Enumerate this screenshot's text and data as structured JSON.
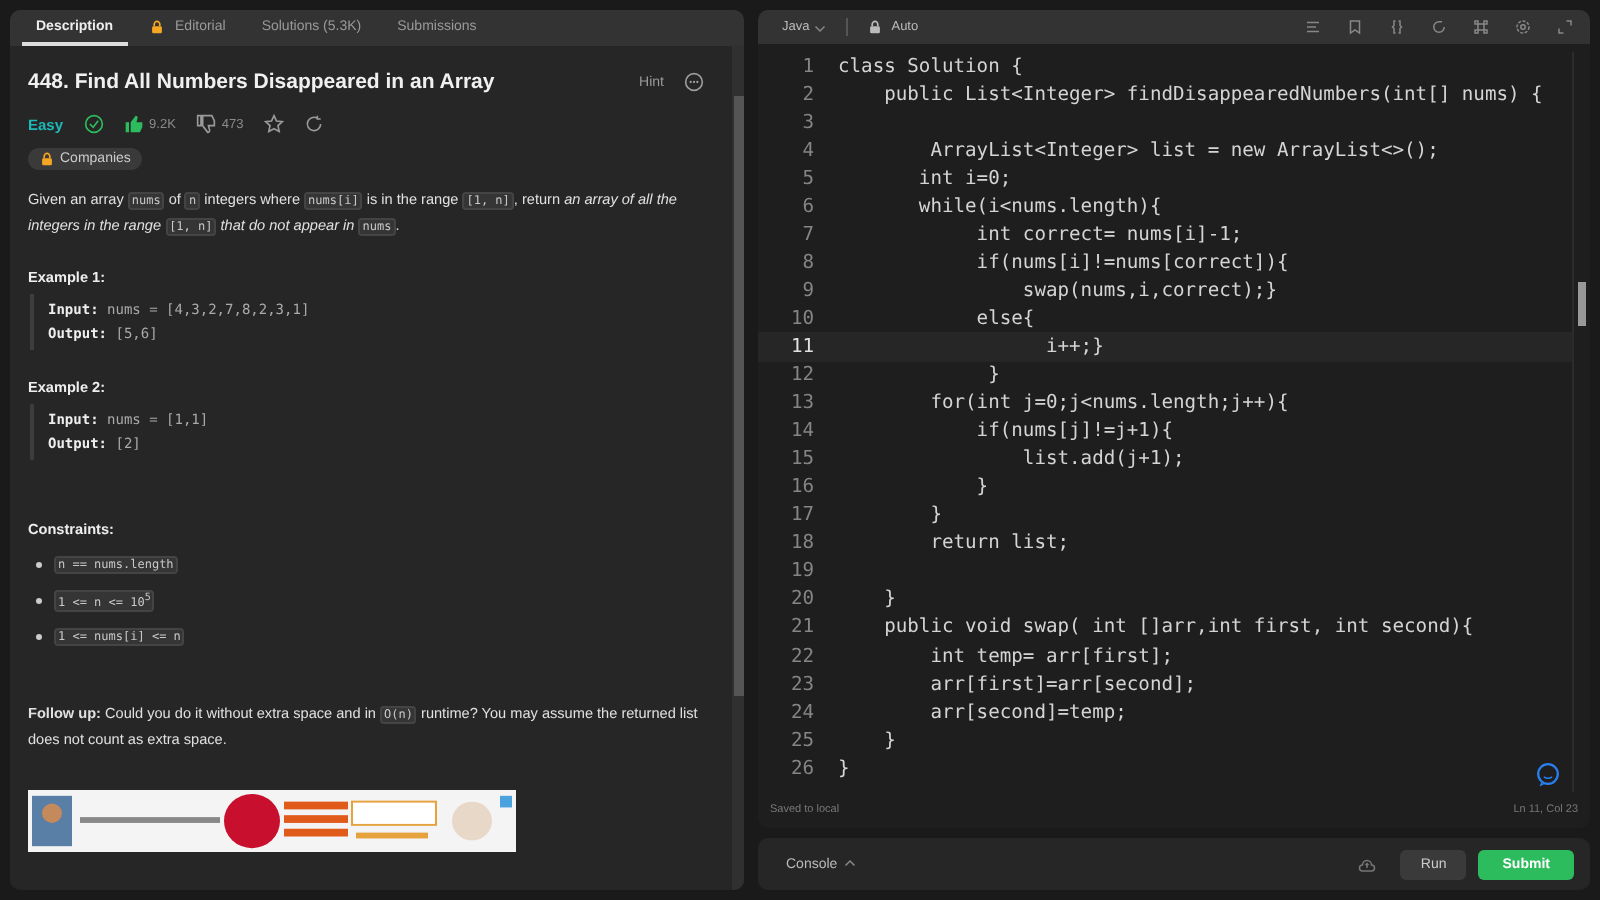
{
  "left_tabs": [
    {
      "label": "Description",
      "selected": true,
      "locked": false
    },
    {
      "label": "Editorial",
      "selected": false,
      "locked": true
    },
    {
      "label": "Solutions (5.3K)",
      "selected": false,
      "locked": false
    },
    {
      "label": "Submissions",
      "selected": false,
      "locked": false
    }
  ],
  "problem": {
    "title": "448. Find All Numbers Disappeared in an Array",
    "hint": "Hint",
    "difficulty": "Easy",
    "solved": true,
    "likes": "9.2K",
    "dislikes": "473",
    "companies": "Companies",
    "statement": [
      {
        "kind": "text",
        "text": "Given an array "
      },
      {
        "kind": "code",
        "text": "nums"
      },
      {
        "kind": "text",
        "text": " of "
      },
      {
        "kind": "code",
        "text": "n"
      },
      {
        "kind": "text",
        "text": " integers where "
      },
      {
        "kind": "code",
        "text": "nums[i]"
      },
      {
        "kind": "text",
        "text": " is in the range "
      },
      {
        "kind": "code",
        "text": "[1, n]"
      },
      {
        "kind": "text",
        "text": ", return "
      },
      {
        "kind": "italic",
        "text": "an array of all the integers in the range "
      },
      {
        "kind": "code",
        "text": "[1, n]"
      },
      {
        "kind": "italic",
        "text": " that do not appear in "
      },
      {
        "kind": "code",
        "text": "nums"
      },
      {
        "kind": "text",
        "text": "."
      }
    ],
    "examples": [
      {
        "title": "Example 1:",
        "input_label": "Input:",
        "input": "nums = [4,3,2,7,8,2,3,1]",
        "output_label": "Output:",
        "output": "[5,6]"
      },
      {
        "title": "Example 2:",
        "input_label": "Input:",
        "input": "nums = [1,1]",
        "output_label": "Output:",
        "output": "[2]"
      }
    ],
    "constraints_title": "Constraints:",
    "constraints": [
      "n == nums.length",
      "1 <= n <= 10$^{5}$",
      "1 <= nums[i] <= n"
    ],
    "follow_up_label": "Follow up:",
    "follow_up": [
      {
        "kind": "text",
        "text": " Could you do it without extra space and in "
      },
      {
        "kind": "code",
        "text": "O(n)"
      },
      {
        "kind": "text",
        "text": " runtime? You may assume the returned list does not count as extra space."
      }
    ],
    "ad": {
      "kind": "picture"
    }
  },
  "editor": {
    "language": "Java",
    "mode": "Auto",
    "lines": [
      {
        "number": "1",
        "text": "class Solution {",
        "current": false
      },
      {
        "number": "2",
        "text": "    public List<Integer> findDisappearedNumbers(int[] nums) {",
        "current": false
      },
      {
        "number": "3",
        "current": false
      },
      {
        "number": "4",
        "text": "        ArrayList<Integer> list = new ArrayList<>();",
        "current": false
      },
      {
        "number": "5",
        "text": "       int i=0;",
        "current": false
      },
      {
        "number": "6",
        "text": "       while(i<nums.length){",
        "current": false
      },
      {
        "number": "7",
        "text": "            int correct= nums[i]-1;",
        "current": false
      },
      {
        "number": "8",
        "text": "            if(nums[i]!=nums[correct]){",
        "current": false
      },
      {
        "number": "9",
        "text": "                swap(nums,i,correct);}",
        "current": false
      },
      {
        "number": "10",
        "text": "            else{",
        "current": false
      },
      {
        "number": "11",
        "text": "                  i++;}",
        "current": true
      },
      {
        "number": "12",
        "text": "             }",
        "current": false
      },
      {
        "number": "13",
        "text": "        for(int j=0;j<nums.length;j++){",
        "current": false
      },
      {
        "number": "14",
        "text": "            if(nums[j]!=j+1){",
        "current": false
      },
      {
        "number": "15",
        "text": "                list.add(j+1);",
        "current": false
      },
      {
        "number": "16",
        "text": "            }",
        "current": false
      },
      {
        "number": "17",
        "text": "        }",
        "current": false
      },
      {
        "number": "18",
        "text": "        return list;",
        "current": false
      },
      {
        "number": "19",
        "current": false
      },
      {
        "number": "20",
        "text": "    }",
        "current": false
      },
      {
        "number": "21",
        "text": "    public void swap( int []arr,int first, int second){",
        "current": false
      },
      {
        "number": "22",
        "text": "        int temp= arr[first];",
        "current": false
      },
      {
        "number": "23",
        "text": "        arr[first]=arr[second];",
        "current": false
      },
      {
        "number": "24",
        "text": "        arr[second]=temp;",
        "current": false
      },
      {
        "number": "25",
        "text": "    }",
        "current": false
      },
      {
        "number": "26",
        "text": "}",
        "current": false
      }
    ],
    "saved": "Saved to local",
    "cursor": "Ln 11, Col 23"
  },
  "console": {
    "label": "Console",
    "run": "Run",
    "submit": "Submit"
  }
}
